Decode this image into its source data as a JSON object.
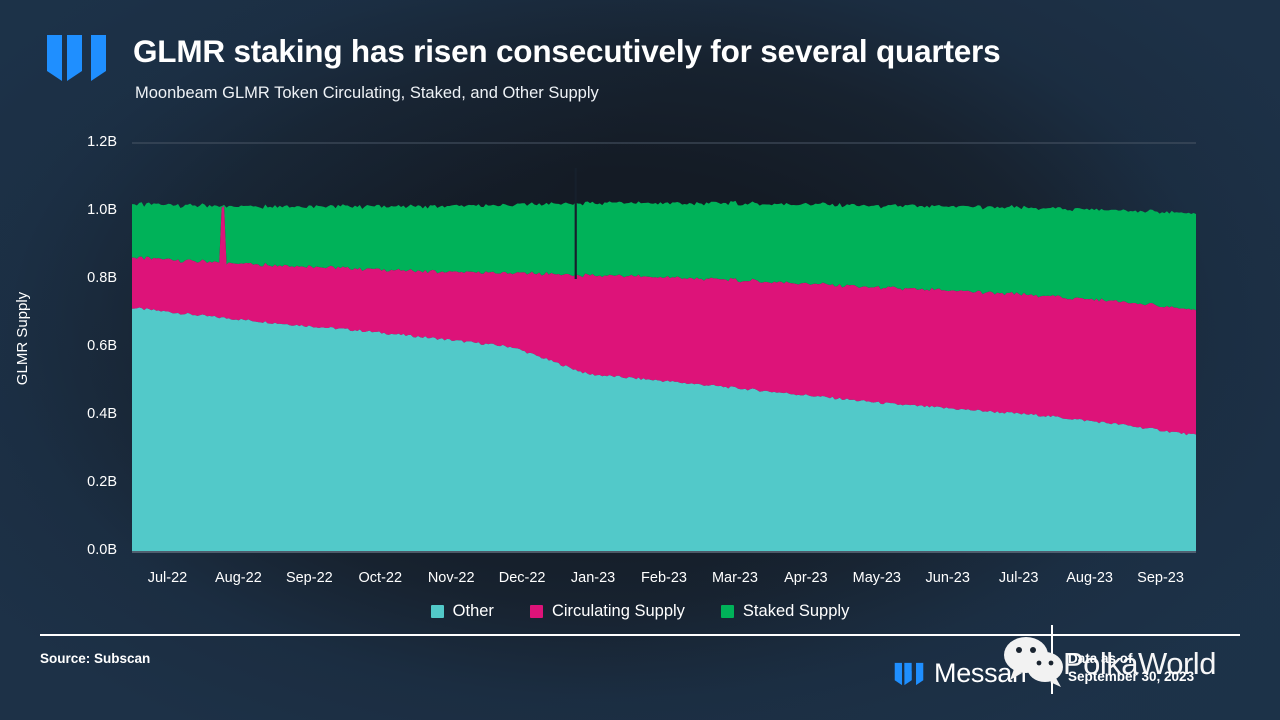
{
  "header": {
    "logo_icon": "messari-m-logo",
    "title": "GLMR staking has risen consecutively for several quarters",
    "subtitle": "Moonbeam GLMR Token Circulating, Staked, and Other Supply"
  },
  "footer": {
    "source": "Source: Subscan",
    "brand": "Messari",
    "brand_logo_icon": "messari-m-logo",
    "asof_label": "Data as of",
    "asof_date": "September 30, 2023"
  },
  "watermark": {
    "icon": "wechat-icon",
    "text": "PolkaWorld"
  },
  "colors": {
    "background_dark": "#141b25",
    "background_edge": "#1d3147",
    "accent_blue": "#1f8fff",
    "other": "#52c9c9",
    "circulating": "#dd1379",
    "staked": "#00b259",
    "grid": "#4a5666",
    "text": "#ffffff"
  },
  "chart_data": {
    "type": "area",
    "title": "GLMR staking has risen consecutively for several quarters",
    "subtitle": "Moonbeam GLMR Token Circulating, Staked, and Other Supply",
    "xlabel": "",
    "ylabel": "GLMR Supply",
    "ylim": [
      0.0,
      1.2
    ],
    "yticks": [
      "0.0B",
      "0.2B",
      "0.4B",
      "0.6B",
      "0.8B",
      "1.0B",
      "1.2B"
    ],
    "ytick_values": [
      0.0,
      0.2,
      0.4,
      0.6,
      0.8,
      1.0,
      1.2
    ],
    "grid": "horizontal-top-only",
    "stacked": true,
    "legend_position": "bottom-center",
    "categories": [
      "Jul-22",
      "Aug-22",
      "Sep-22",
      "Oct-22",
      "Nov-22",
      "Dec-22",
      "Jan-23",
      "Feb-23",
      "Mar-23",
      "Apr-23",
      "May-23",
      "Jun-23",
      "Jul-23",
      "Aug-23",
      "Sep-23"
    ],
    "series": [
      {
        "name": "Other",
        "color": "#52c9c9",
        "values": [
          0.715,
          0.69,
          0.668,
          0.648,
          0.625,
          0.6,
          0.52,
          0.5,
          0.478,
          0.455,
          0.432,
          0.415,
          0.398,
          0.372,
          0.34
        ]
      },
      {
        "name": "Circulating Supply",
        "color": "#dd1379",
        "values": [
          0.148,
          0.16,
          0.172,
          0.182,
          0.196,
          0.218,
          0.29,
          0.305,
          0.318,
          0.33,
          0.34,
          0.348,
          0.352,
          0.362,
          0.368
        ]
      },
      {
        "name": "Staked Supply",
        "color": "#00b259",
        "values": [
          0.157,
          0.164,
          0.174,
          0.184,
          0.192,
          0.2,
          0.212,
          0.218,
          0.226,
          0.234,
          0.242,
          0.249,
          0.258,
          0.268,
          0.284
        ]
      }
    ],
    "notes": [
      "Stack order bottom-to-top: Other, Circulating Supply, Staked Supply",
      "Total supply grows from ~1.02B to ~0.99B-1.00B across the period",
      "Narrow data spike in Circulating Supply near Aug-22",
      "Narrow data gap near Jan-23"
    ]
  }
}
